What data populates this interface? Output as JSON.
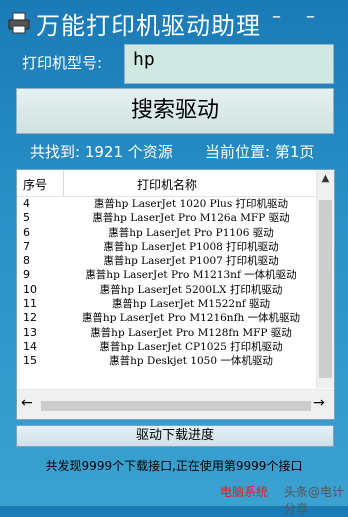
{
  "app": {
    "title": "万能打印机驱动助理",
    "minimize_glyph": "–",
    "close_glyph": "–"
  },
  "search": {
    "label": "打印机型号:",
    "value": "hp",
    "button_label": "搜索驱动"
  },
  "results": {
    "count_text": "共找到: 1921 个资源",
    "page_text": "当前位置: 第1页"
  },
  "table": {
    "headers": {
      "no": "序号",
      "name": "打印机名称"
    },
    "rows": [
      {
        "no": "4",
        "name": "惠普hp LaserJet 1020 Plus 打印机驱动"
      },
      {
        "no": "5",
        "name": "惠普hp LaserJet Pro M126a MFP 驱动"
      },
      {
        "no": "6",
        "name": "惠普hp LaserJet Pro P1106 驱动"
      },
      {
        "no": "7",
        "name": "惠普hp LaserJet P1008 打印机驱动"
      },
      {
        "no": "8",
        "name": "惠普hp LaserJet P1007 打印机驱动"
      },
      {
        "no": "9",
        "name": "惠普hp LaserJet Pro M1213nf 一体机驱动"
      },
      {
        "no": "10",
        "name": "惠普hp LaserJet 5200LX 打印机驱动"
      },
      {
        "no": "11",
        "name": "惠普hp LaserJet M1522nf 驱动"
      },
      {
        "no": "12",
        "name": "惠普hp LaserJet Pro M1216nfh 一体机驱动"
      },
      {
        "no": "13",
        "name": "惠普hp LaserJet Pro M128fn MFP 驱动"
      },
      {
        "no": "14",
        "name": "惠普hp LaserJet CP1025 打印机驱动"
      },
      {
        "no": "15",
        "name": "惠普hp Deskjet 1050 一体机驱动"
      }
    ]
  },
  "scroll": {
    "up": "▲",
    "left": "←",
    "right": "→"
  },
  "download": {
    "label": "驱动下载进度"
  },
  "status": {
    "text": "共发现9999个下载接口,正在使用第9999个接口"
  },
  "watermark": {
    "left": "电脑系统",
    "right": "头条@电计分享"
  },
  "colors": {
    "background": "#2a92c8",
    "watermark": "#e02020"
  }
}
